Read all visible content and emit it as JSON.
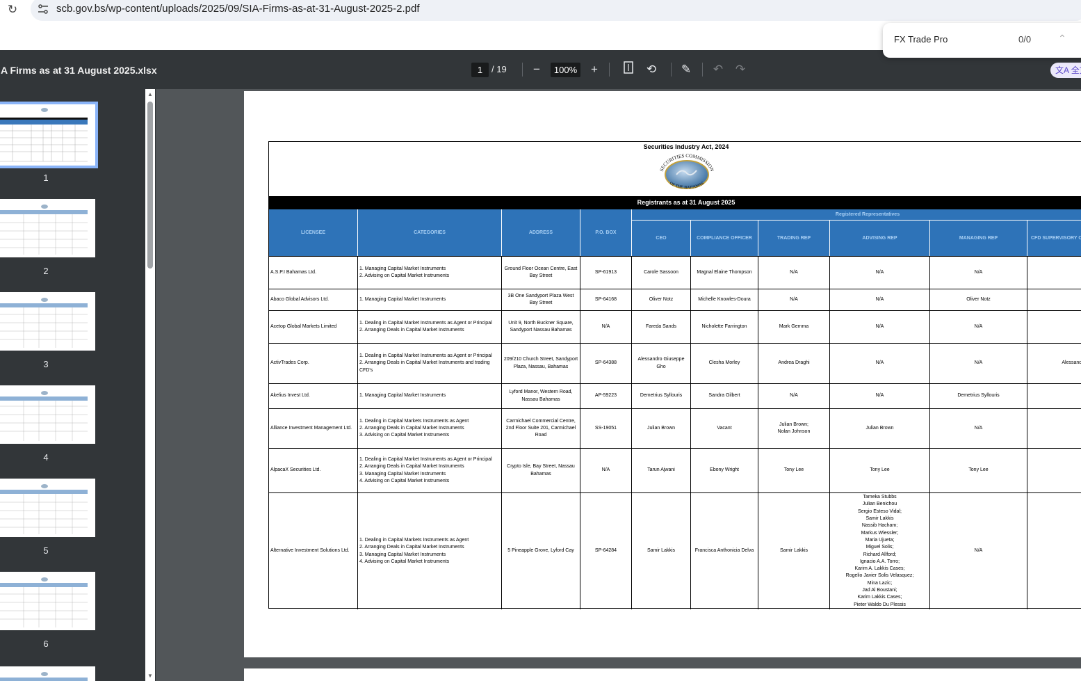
{
  "browser": {
    "url": "scb.gov.bs/wp-content/uploads/2025/09/SIA-Firms-as-at-31-August-2025-2.pdf",
    "reload_icon": "reload-icon",
    "site_icon": "tune-icon"
  },
  "find_bar": {
    "query": "FX Trade Pro",
    "count": "0/0"
  },
  "toolbar": {
    "title": "A Firms as at 31 August 2025.xlsx",
    "page_current": "1",
    "page_total": "/ 19",
    "zoom": "100%",
    "translate_label": "全文"
  },
  "thumbnails": [
    "1",
    "2",
    "3",
    "4",
    "5",
    "6"
  ],
  "document": {
    "act_title": "Securities Industry Act, 2024",
    "logo_top_text": "SECURITIES COMMISSION",
    "logo_bottom_text": "OF THE BAHAMAS",
    "registrants_title": "Registrants as at 31 August 2025",
    "rep_group_label": "Registered Representatives",
    "headers": {
      "licensee": "LICENSEE",
      "categories": "CATEGORIES",
      "address": "ADDRESS",
      "pobox": "P.O. BOX",
      "ceo": "CEO",
      "compliance": "COMPLIANCE OFFICER",
      "trading": "TRADING REP",
      "advising": "ADVISING REP",
      "managing": "MANAGING REP",
      "cfd": "CFD SUPERVISORY O"
    },
    "rows": [
      {
        "licensee": "A.S.P.I Bahamas Ltd.",
        "categories": "1. Managing Capital Market Instruments\n2. Advising on Capital Market Instruments",
        "address": "Ground Floor  Ocean Centre, East Bay Street",
        "pobox": "SP-61913",
        "ceo": "Carole Sassoon",
        "compliance": "Magnal Elaine Thompson",
        "trading": "N/A",
        "advising": "N/A",
        "managing": "N/A",
        "cfd": ""
      },
      {
        "licensee": "Abaco Global Advisors Ltd.",
        "categories": "1. Managing Capital Market Instruments",
        "address": "3B One Sandyport Plaza  West Bay Street",
        "pobox": "SP-64168",
        "ceo": "Oliver Notz",
        "compliance": "Michelle Knowles-Doura",
        "trading": "N/A",
        "advising": "N/A",
        "managing": "Oliver Notz",
        "cfd": ""
      },
      {
        "licensee": "Acetop Global Markets Limited",
        "categories": "1. Dealing in Capital Market Instruments as Agent or Principal\n2. Arranging Deals in Capital Market Instruments",
        "address": "Unit 9, North Buckner Square, Sandyport Nassau Bahamas",
        "pobox": "N/A",
        "ceo": "Fareda Sands",
        "compliance": "Nicholette Farrington",
        "trading": "Mark Gemma",
        "advising": "N/A",
        "managing": "N/A",
        "cfd": ""
      },
      {
        "licensee": "ActivTrades Corp.",
        "categories": "1. Dealing in Capital Market Instruments as Agent or Principal\n2. Arranging Deals in Capital Market Instruments and trading CFD's",
        "address": "209/210 Church Street, Sandyport Plaza, Nassau, Bahamas",
        "pobox": "SP-64388",
        "ceo": "Alessandro Giuseppe Gho",
        "compliance": "Clesha Morley",
        "trading": "Andrea Draghi",
        "advising": "N/A",
        "managing": "N/A",
        "cfd": "Alessandro  Gho"
      },
      {
        "licensee": "Akelius Invest Ltd.",
        "categories": "1. Managing Capital Market Instruments",
        "address": "Lyford Manor, Western Road, Nassau Bahamas",
        "pobox": "AP-59223",
        "ceo": "Demetrius Syllouris",
        "compliance": "Sandra Gilbert",
        "trading": "N/A",
        "advising": "N/A",
        "managing": "Demetrius Syllouris",
        "cfd": ""
      },
      {
        "licensee": "Alliance Investment Management Ltd.",
        "categories": "1. Dealing in Capital Markets Instruments as Agent\n2. Arranging Deals in Capital Market Instruments\n3. Advising on Capital Market Instruments",
        "address": "Carmichael Commercial Centre, 2nd Floor Suite 201, Carmichael Road",
        "pobox": "SS-19051",
        "ceo": "Julian Brown",
        "compliance": "Vacant",
        "trading": "Julian Brown;\nNolan Johnson",
        "advising": "Julian Brown",
        "managing": "N/A",
        "cfd": ""
      },
      {
        "licensee": "AlpacaX Securities Ltd.",
        "categories": "1. Dealing in Capital Market Instruments as Agent or Principal\n2. Arranging Deals in Capital Market Instruments\n3. Managing Capital Market Instruments\n4. Advising on Capital Market Instruments",
        "address": "Crypto Isle, Bay Street, Nassau Bahamas",
        "pobox": "N/A",
        "ceo": "Tarun Ajwani",
        "compliance": "Ebony Wright",
        "trading": "Tony Lee",
        "advising": "Tony Lee",
        "managing": "Tony Lee",
        "cfd": ""
      },
      {
        "licensee": "Alternative Investment Solutions Ltd.",
        "categories": "1. Dealing in Capital Markets Instruments as Agent\n2. Arranging Deals in Capital Market Instruments\n3. Managing Capital Market Instruments\n4. Advising on Capital Market Instruments",
        "address": "5 Pineapple Grove, Lyford Cay",
        "pobox": "SP-64284",
        "ceo": "Samir Lakkis",
        "compliance": "Francisca Anthonicia Delva",
        "trading": "Samir Lakkis",
        "advising": "Tameka Stubbs\nJulian Benichou\nSergio Esteso Vidal;\nSamir Lakkis\nNassib Hacham;\nMarkus Wiessler;\nMaria Ujueta;\nMiguel Solis;\nRichard Allford;\nIgnacio A.A. Torro;\nKarim A. Lakkis Cases;\nRogelio Javier Solis Velasquez;\nMina Lazic;\nJad Al Boustani;\nKarim Lakkis Cases;\nPieter Waldo Du Plessis",
        "managing": "N/A",
        "cfd": ""
      }
    ]
  }
}
